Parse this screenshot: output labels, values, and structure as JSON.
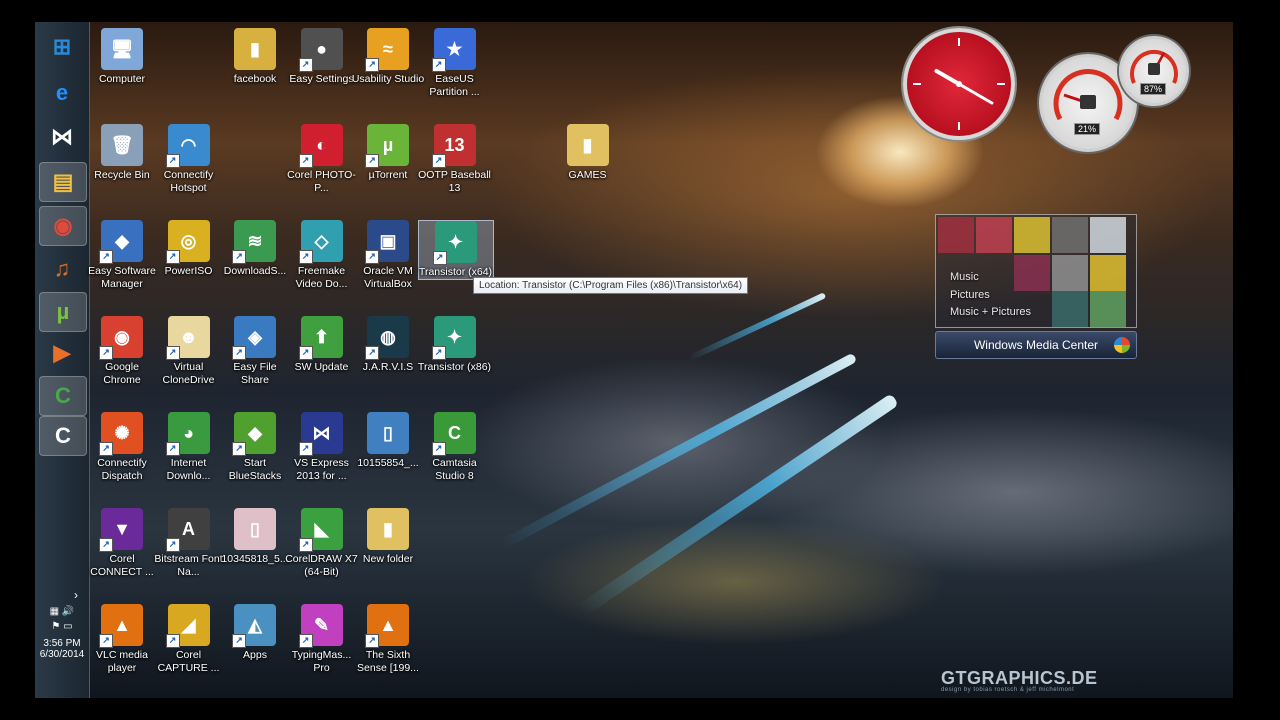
{
  "taskbar": {
    "clock_time": "3:56 PM",
    "clock_date": "6/30/2014",
    "expand_arrow": "›",
    "pinned": [
      {
        "name": "start-button",
        "glyph": "⊞",
        "color": "#2a8ad8",
        "active": false
      },
      {
        "name": "taskbar-internet-explorer",
        "glyph": "e",
        "color": "#1e90ff",
        "active": false
      },
      {
        "name": "taskbar-visual-studio",
        "glyph": "⋈",
        "color": "#ffffff",
        "active": false
      },
      {
        "name": "taskbar-explorer",
        "glyph": "▤",
        "color": "#f0c040",
        "active": true
      },
      {
        "name": "taskbar-chrome",
        "glyph": "◉",
        "color": "#e04a3a",
        "active": true
      },
      {
        "name": "taskbar-media-player",
        "glyph": "♫",
        "color": "#e07020",
        "active": false
      },
      {
        "name": "taskbar-utorrent",
        "glyph": "µ",
        "color": "#7ac143",
        "active": true
      },
      {
        "name": "taskbar-player",
        "glyph": "▶",
        "color": "#e8702a",
        "active": false
      },
      {
        "name": "taskbar-camtasia",
        "glyph": "C",
        "color": "#4aa84a",
        "active": true
      },
      {
        "name": "taskbar-camtasia-recorder",
        "glyph": "C",
        "color": "#ffffff",
        "active": true
      }
    ]
  },
  "desktop_icons": [
    {
      "label": "Computer",
      "col": 0,
      "row": 0,
      "glyph": "🖥",
      "bg": "#7fa8d8",
      "shortcut": false
    },
    {
      "label": "facebook",
      "col": 2,
      "row": 0,
      "glyph": "▮",
      "bg": "#d8b040",
      "shortcut": false
    },
    {
      "label": "Easy Settings",
      "col": 3,
      "row": 0,
      "glyph": "●",
      "bg": "#505050",
      "shortcut": true
    },
    {
      "label": "Usability Studio",
      "col": 4,
      "row": 0,
      "glyph": "≈",
      "bg": "#e8a020",
      "shortcut": true
    },
    {
      "label": "EaseUS Partition ...",
      "col": 5,
      "row": 0,
      "glyph": "★",
      "bg": "#3a6ad8",
      "shortcut": true
    },
    {
      "label": "Recycle Bin",
      "col": 0,
      "row": 1,
      "glyph": "🗑",
      "bg": "#8aa0b8",
      "shortcut": false
    },
    {
      "label": "Connectify Hotspot",
      "col": 1,
      "row": 1,
      "glyph": "◠",
      "bg": "#3a8ad0",
      "shortcut": true
    },
    {
      "label": "Corel PHOTO-P...",
      "col": 3,
      "row": 1,
      "glyph": "◐",
      "bg": "#d02030",
      "shortcut": true
    },
    {
      "label": "µTorrent",
      "col": 4,
      "row": 1,
      "glyph": "µ",
      "bg": "#6ab43a",
      "shortcut": true
    },
    {
      "label": "OOTP Baseball 13",
      "col": 5,
      "row": 1,
      "glyph": "13",
      "bg": "#c03030",
      "shortcut": true
    },
    {
      "label": "GAMES",
      "col": 7,
      "row": 1,
      "glyph": "▮",
      "bg": "#e0c060",
      "shortcut": false
    },
    {
      "label": "Easy Software Manager",
      "col": 0,
      "row": 2,
      "glyph": "◆",
      "bg": "#3a70c0",
      "shortcut": true
    },
    {
      "label": "PowerISO",
      "col": 1,
      "row": 2,
      "glyph": "◎",
      "bg": "#d8b020",
      "shortcut": true
    },
    {
      "label": "DownloadS...",
      "col": 2,
      "row": 2,
      "glyph": "≋",
      "bg": "#3a9a50",
      "shortcut": true
    },
    {
      "label": "Freemake Video Do...",
      "col": 3,
      "row": 2,
      "glyph": "◇",
      "bg": "#30a0b0",
      "shortcut": true
    },
    {
      "label": "Oracle VM VirtualBox",
      "col": 4,
      "row": 2,
      "glyph": "▣",
      "bg": "#2a4a8a",
      "shortcut": true
    },
    {
      "label": "Transistor (x64)",
      "col": 5,
      "row": 2,
      "glyph": "✦",
      "bg": "#2a9a7a",
      "shortcut": true,
      "selected": true
    },
    {
      "label": "Google Chrome",
      "col": 0,
      "row": 3,
      "glyph": "◉",
      "bg": "#d84030",
      "shortcut": true
    },
    {
      "label": "Virtual CloneDrive",
      "col": 1,
      "row": 3,
      "glyph": "☻",
      "bg": "#e8d8a0",
      "shortcut": true
    },
    {
      "label": "Easy File Share",
      "col": 2,
      "row": 3,
      "glyph": "◈",
      "bg": "#3a7ac0",
      "shortcut": true
    },
    {
      "label": "SW Update",
      "col": 3,
      "row": 3,
      "glyph": "⬆",
      "bg": "#40a040",
      "shortcut": true
    },
    {
      "label": "J.A.R.V.I.S",
      "col": 4,
      "row": 3,
      "glyph": "◍",
      "bg": "#1a3a4a",
      "shortcut": true
    },
    {
      "label": "Transistor (x86)",
      "col": 5,
      "row": 3,
      "glyph": "✦",
      "bg": "#2a9a7a",
      "shortcut": true
    },
    {
      "label": "Connectify Dispatch",
      "col": 0,
      "row": 4,
      "glyph": "✺",
      "bg": "#e05020",
      "shortcut": true
    },
    {
      "label": "Internet Downlo...",
      "col": 1,
      "row": 4,
      "glyph": "◕",
      "bg": "#3a9a40",
      "shortcut": true
    },
    {
      "label": "Start BlueStacks",
      "col": 2,
      "row": 4,
      "glyph": "◆",
      "bg": "#50a030",
      "shortcut": true
    },
    {
      "label": "VS Express 2013 for ...",
      "col": 3,
      "row": 4,
      "glyph": "⋈",
      "bg": "#2a3a90",
      "shortcut": true
    },
    {
      "label": "10155854_...",
      "col": 4,
      "row": 4,
      "glyph": "▯",
      "bg": "#4080c0",
      "shortcut": false
    },
    {
      "label": "Camtasia Studio 8",
      "col": 5,
      "row": 4,
      "glyph": "C",
      "bg": "#3a9a3a",
      "shortcut": true
    },
    {
      "label": "Corel CONNECT ...",
      "col": 0,
      "row": 5,
      "glyph": "▼",
      "bg": "#6a2a9a",
      "shortcut": true
    },
    {
      "label": "Bitstream Font Na...",
      "col": 1,
      "row": 5,
      "glyph": "A",
      "bg": "#404040",
      "shortcut": true
    },
    {
      "label": "10345818_5...",
      "col": 2,
      "row": 5,
      "glyph": "▯",
      "bg": "#e0c0c8",
      "shortcut": false
    },
    {
      "label": "CorelDRAW X7 (64-Bit)",
      "col": 3,
      "row": 5,
      "glyph": "◣",
      "bg": "#3aa040",
      "shortcut": true
    },
    {
      "label": "New folder",
      "col": 4,
      "row": 5,
      "glyph": "▮",
      "bg": "#e0c060",
      "shortcut": false
    },
    {
      "label": "VLC media player",
      "col": 0,
      "row": 6,
      "glyph": "▲",
      "bg": "#e07010",
      "shortcut": true
    },
    {
      "label": "Corel CAPTURE ...",
      "col": 1,
      "row": 6,
      "glyph": "◢",
      "bg": "#d8a820",
      "shortcut": true
    },
    {
      "label": "Apps",
      "col": 2,
      "row": 6,
      "glyph": "◭",
      "bg": "#4a90c0",
      "shortcut": true
    },
    {
      "label": "TypingMas... Pro",
      "col": 3,
      "row": 6,
      "glyph": "✎",
      "bg": "#c040c0",
      "shortcut": true
    },
    {
      "label": "The Sixth Sense [199...",
      "col": 4,
      "row": 6,
      "glyph": "▲",
      "bg": "#e07010",
      "shortcut": true
    }
  ],
  "tooltip": {
    "text": "Location: Transistor (C:\\Program Files (x86)\\Transistor\\x64)"
  },
  "gadgets": {
    "cpu_meter": {
      "cpu_percent": "21%",
      "memory_percent": "87%"
    },
    "clock": {
      "hour_angle": 300,
      "minute_angle": 120
    }
  },
  "media_center": {
    "menu": [
      "Music",
      "Pictures",
      "Music + Pictures"
    ],
    "title": "Windows Media Center"
  },
  "watermark": {
    "text": "GTGRAPHICS.DE",
    "sub": "design by tobias roetsch & jeff michelmont"
  }
}
